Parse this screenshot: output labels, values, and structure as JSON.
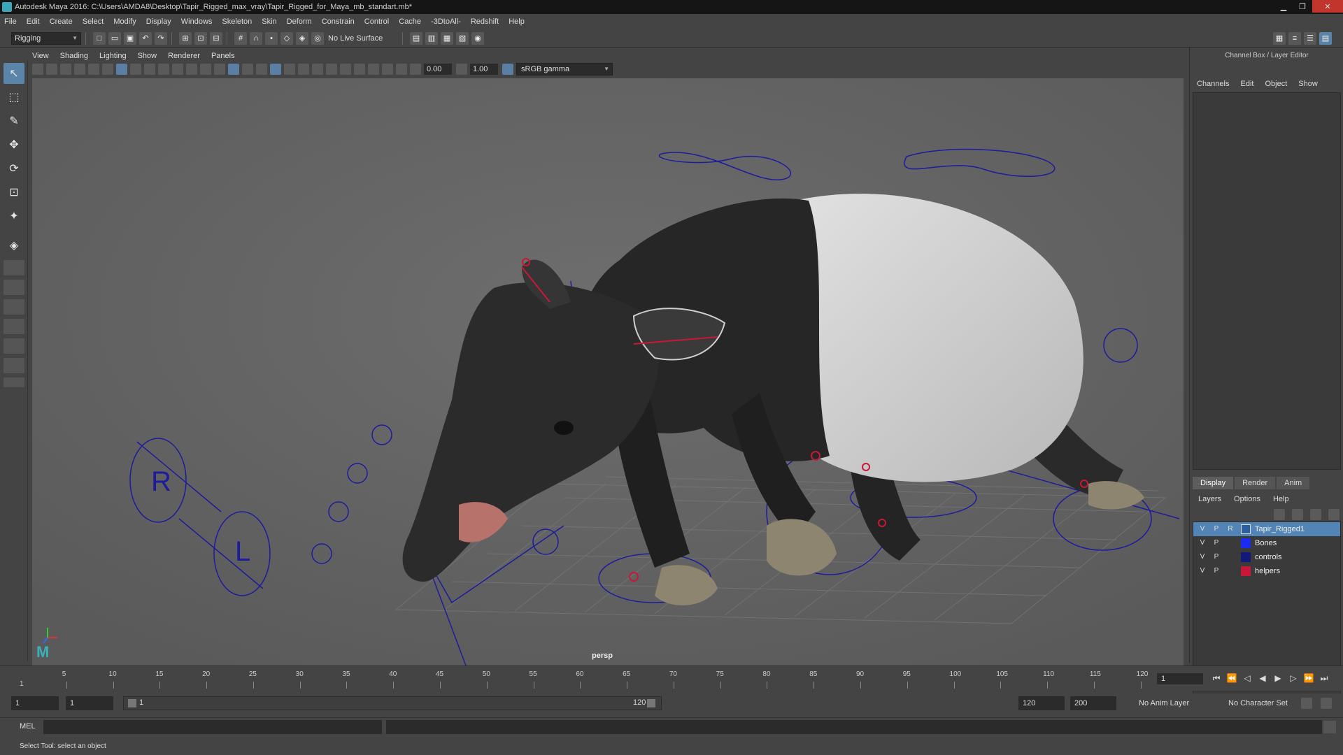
{
  "window": {
    "title": "Autodesk Maya 2016: C:\\Users\\AMDA8\\Desktop\\Tapir_Rigged_max_vray\\Tapir_Rigged_for_Maya_mb_standart.mb*",
    "minimize": "▁",
    "maximize": "❐",
    "close": "✕"
  },
  "menubar": [
    "File",
    "Edit",
    "Create",
    "Select",
    "Modify",
    "Display",
    "Windows",
    "Skeleton",
    "Skin",
    "Deform",
    "Constrain",
    "Control",
    "Cache",
    "-3DtoAll-",
    "Redshift",
    "Help"
  ],
  "shelf": {
    "mode": "Rigging",
    "live_surface": "No Live Surface"
  },
  "viewport": {
    "menus": [
      "View",
      "Shading",
      "Lighting",
      "Show",
      "Renderer",
      "Panels"
    ],
    "exposure": "0.00",
    "gamma_value": "1.00",
    "color_space": "sRGB gamma",
    "camera_label": "persp"
  },
  "channel_box": {
    "title": "Channel Box / Layer Editor",
    "menus": [
      "Channels",
      "Edit",
      "Object",
      "Show"
    ]
  },
  "layer_editor": {
    "tabs": [
      "Display",
      "Render",
      "Anim"
    ],
    "menus": [
      "Layers",
      "Options",
      "Help"
    ],
    "layers": [
      {
        "v": "V",
        "p": "P",
        "r": "R",
        "name": "Tapir_Rigged1",
        "color": "#2a5fa0",
        "selected": true
      },
      {
        "v": "V",
        "p": "P",
        "r": "",
        "name": "Bones",
        "color": "#1a2cf0",
        "selected": false
      },
      {
        "v": "V",
        "p": "P",
        "r": "",
        "name": "controls",
        "color": "#111a7a",
        "selected": false
      },
      {
        "v": "V",
        "p": "P",
        "r": "",
        "name": "helpers",
        "color": "#c8183a",
        "selected": false
      }
    ]
  },
  "timeslider": {
    "ticks": [
      "5",
      "10",
      "15",
      "20",
      "25",
      "30",
      "35",
      "40",
      "45",
      "50",
      "55",
      "60",
      "65",
      "70",
      "75",
      "80",
      "85",
      "90",
      "95",
      "100",
      "105",
      "110",
      "115",
      "120"
    ],
    "current_frame": "1",
    "start_marker": "1"
  },
  "range": {
    "start": "1",
    "anim_start": "1",
    "slider_start": "1",
    "slider_end": "120",
    "playback_end": "120",
    "anim_end": "200",
    "anim_layer": "No Anim Layer",
    "character_set": "No Character Set"
  },
  "command": {
    "language": "MEL"
  },
  "help_line": "Select Tool: select an object",
  "colors": {
    "accent": "#5285b5",
    "rig_blue": "#1c1c9c",
    "rig_red": "#c8183a"
  }
}
